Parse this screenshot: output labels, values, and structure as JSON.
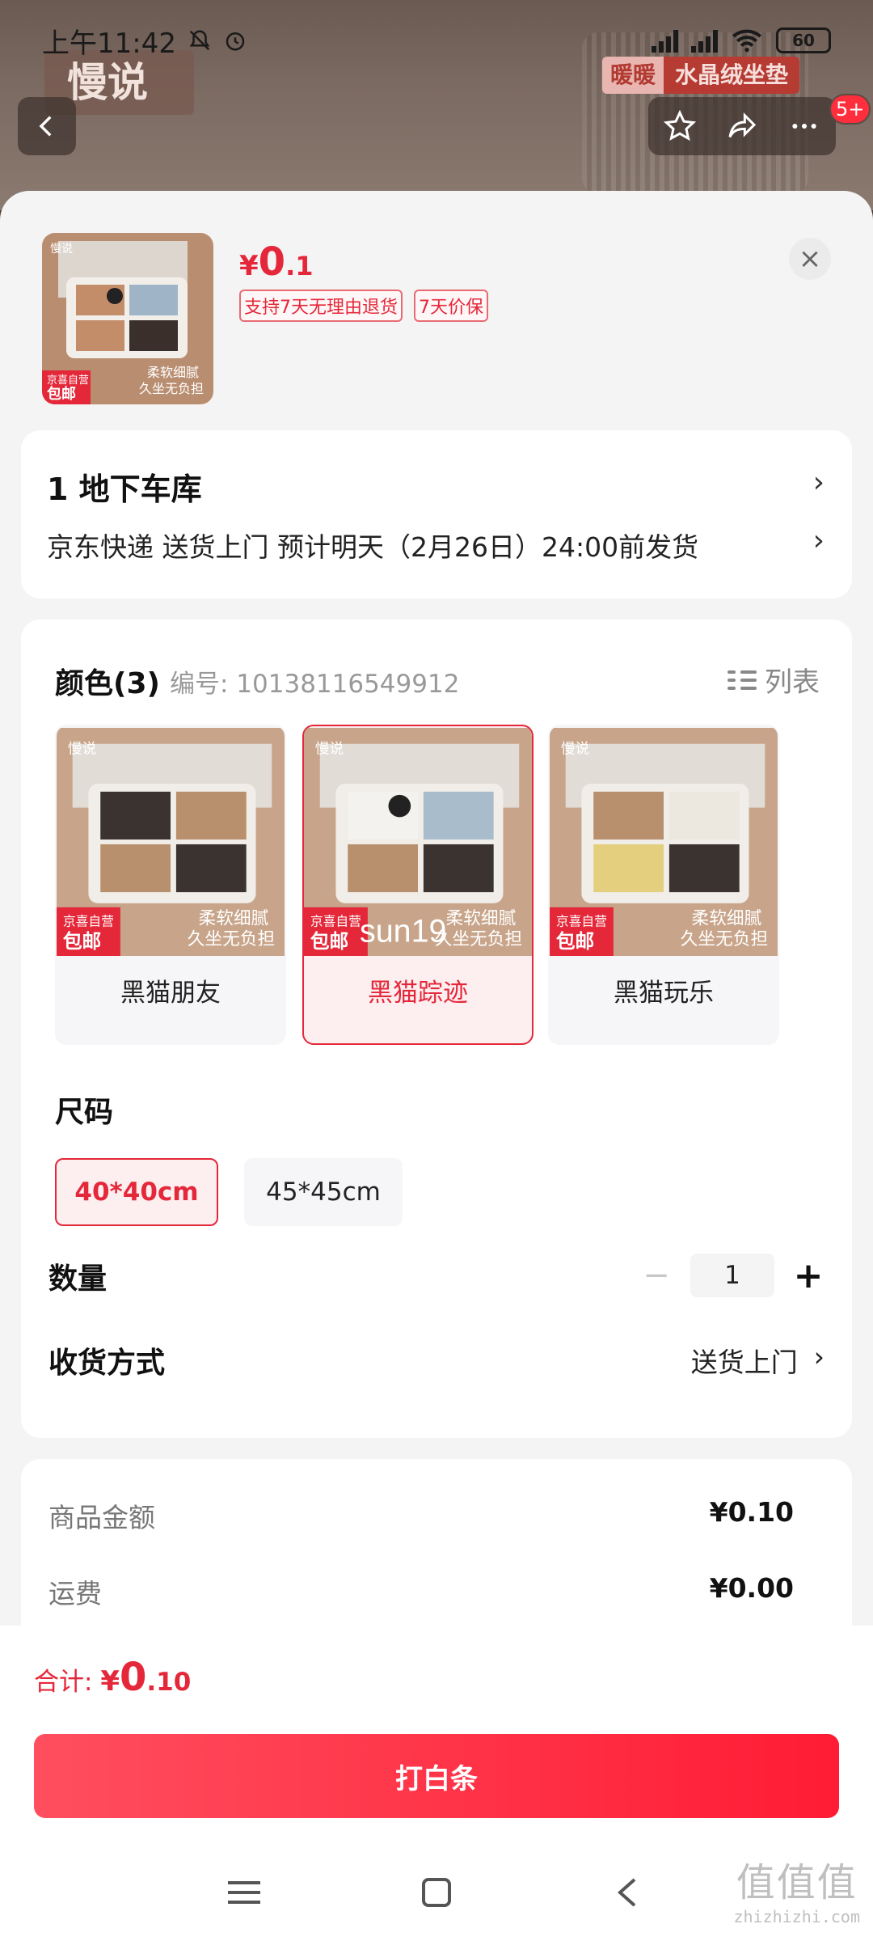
{
  "status_bar": {
    "time": "上午11:42",
    "battery": "60"
  },
  "background": {
    "brand_logo": "慢说",
    "promo_tag_1": "暖暖",
    "promo_tag_2": "水晶绒坐垫",
    "notification_badge": "5+"
  },
  "product": {
    "price_symbol": "¥",
    "price_int": "0",
    "price_dec": ".1",
    "tags": [
      "支持7天无理由退货",
      "7天价保"
    ]
  },
  "address": {
    "line1": "1  地下车库",
    "line2": "京东快递 送货上门 预计明天（2月26日）24:00前发货"
  },
  "spec": {
    "color_title": "颜色(3)",
    "sku_label": "编号: 10138116549912",
    "list_toggle": "列表",
    "colors": [
      {
        "label": "黑猫朋友",
        "selected": false
      },
      {
        "label": "黑猫踪迹",
        "selected": true
      },
      {
        "label": "黑猫玩乐",
        "selected": false
      }
    ],
    "thumb_text": {
      "logo": "慢说",
      "badge_top": "京喜自营",
      "badge_bottom": "包邮",
      "slogan1": "柔软细腻",
      "slogan2": "久坐无负担",
      "overlay": "sun19"
    },
    "size_title": "尺码",
    "sizes": [
      {
        "label": "40*40cm",
        "selected": true
      },
      {
        "label": "45*45cm",
        "selected": false
      }
    ],
    "qty_label": "数量",
    "qty_value": "1",
    "qty_minus": "−",
    "qty_plus": "+",
    "ship_label": "收货方式",
    "ship_value": "送货上门"
  },
  "fees": [
    {
      "k": "商品金额",
      "v": "¥0.10"
    },
    {
      "k": "运费",
      "v": "¥0.00"
    }
  ],
  "total": {
    "label": "合计: ",
    "sym": "¥",
    "int": "0",
    "dec": ".10"
  },
  "pay_button": "打白条",
  "watermark": {
    "big": "值值值",
    "small": "zhizhizhi.com"
  },
  "colors": {
    "accent": "#e4283a",
    "button_start": "#ff4e5f",
    "button_end": "#ff1c34"
  }
}
